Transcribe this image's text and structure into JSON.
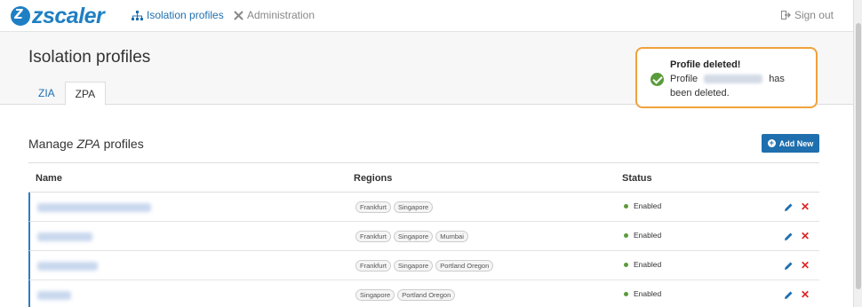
{
  "brand": {
    "name": "zscaler"
  },
  "nav": {
    "isolation_label": "Isolation profiles",
    "admin_label": "Administration",
    "signout_label": "Sign out"
  },
  "page": {
    "title": "Isolation profiles"
  },
  "tabs": [
    {
      "label": "ZIA",
      "active": false
    },
    {
      "label": "ZPA",
      "active": true
    }
  ],
  "toast": {
    "title": "Profile deleted!",
    "prefix": "Profile",
    "suffix": "has",
    "line2": "been deleted."
  },
  "section": {
    "title_prefix": "Manage ",
    "title_em": "ZPA",
    "title_suffix": " profiles"
  },
  "add_button": {
    "label": "Add New"
  },
  "table": {
    "headers": {
      "name": "Name",
      "regions": "Regions",
      "status": "Status"
    },
    "rows": [
      {
        "regions": [
          "Frankfurt",
          "Singapore"
        ],
        "status": "Enabled"
      },
      {
        "regions": [
          "Frankfurt",
          "Singapore",
          "Mumbai"
        ],
        "status": "Enabled"
      },
      {
        "regions": [
          "Frankfurt",
          "Singapore",
          "Portland Oregon"
        ],
        "status": "Enabled"
      },
      {
        "regions": [
          "Singapore",
          "Portland Oregon"
        ],
        "status": "Enabled"
      }
    ]
  },
  "colors": {
    "accent": "#1f6fae",
    "toast_border": "#f0a13c",
    "success": "#5a9b3b",
    "danger": "#dd2222"
  }
}
